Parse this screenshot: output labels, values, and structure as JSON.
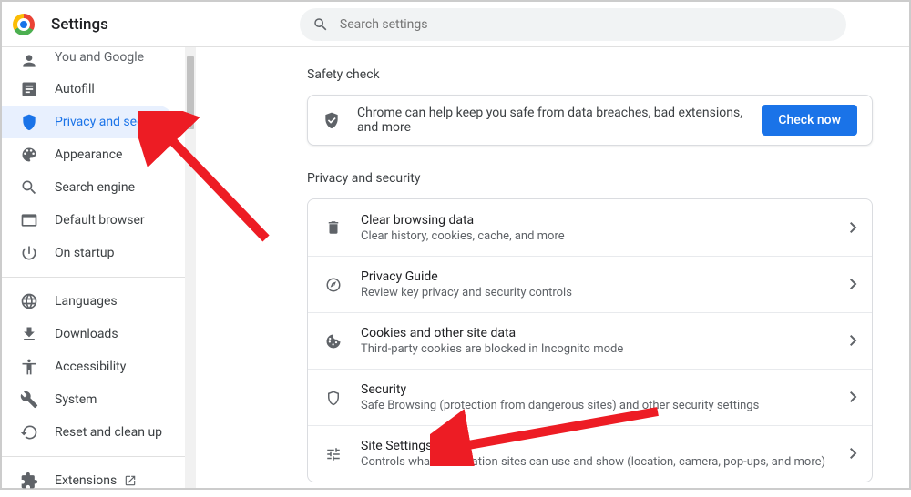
{
  "header": {
    "title": "Settings",
    "search_placeholder": "Search settings"
  },
  "sidebar": {
    "items": [
      {
        "label": "You and Google"
      },
      {
        "label": "Autofill"
      },
      {
        "label": "Privacy and security"
      },
      {
        "label": "Appearance"
      },
      {
        "label": "Search engine"
      },
      {
        "label": "Default browser"
      },
      {
        "label": "On startup"
      },
      {
        "label": "Languages"
      },
      {
        "label": "Downloads"
      },
      {
        "label": "Accessibility"
      },
      {
        "label": "System"
      },
      {
        "label": "Reset and clean up"
      },
      {
        "label": "Extensions"
      }
    ]
  },
  "content": {
    "safety_check_label": "Safety check",
    "safety_text": "Chrome can help keep you safe from data breaches, bad extensions, and more",
    "check_now": "Check now",
    "privacy_label": "Privacy and security",
    "rows": [
      {
        "title": "Clear browsing data",
        "sub": "Clear history, cookies, cache, and more"
      },
      {
        "title": "Privacy Guide",
        "sub": "Review key privacy and security controls"
      },
      {
        "title": "Cookies and other site data",
        "sub": "Third-party cookies are blocked in Incognito mode"
      },
      {
        "title": "Security",
        "sub": "Safe Browsing (protection from dangerous sites) and other security settings"
      },
      {
        "title": "Site Settings",
        "sub": "Controls what information sites can use and show (location, camera, pop-ups, and more)"
      }
    ]
  }
}
